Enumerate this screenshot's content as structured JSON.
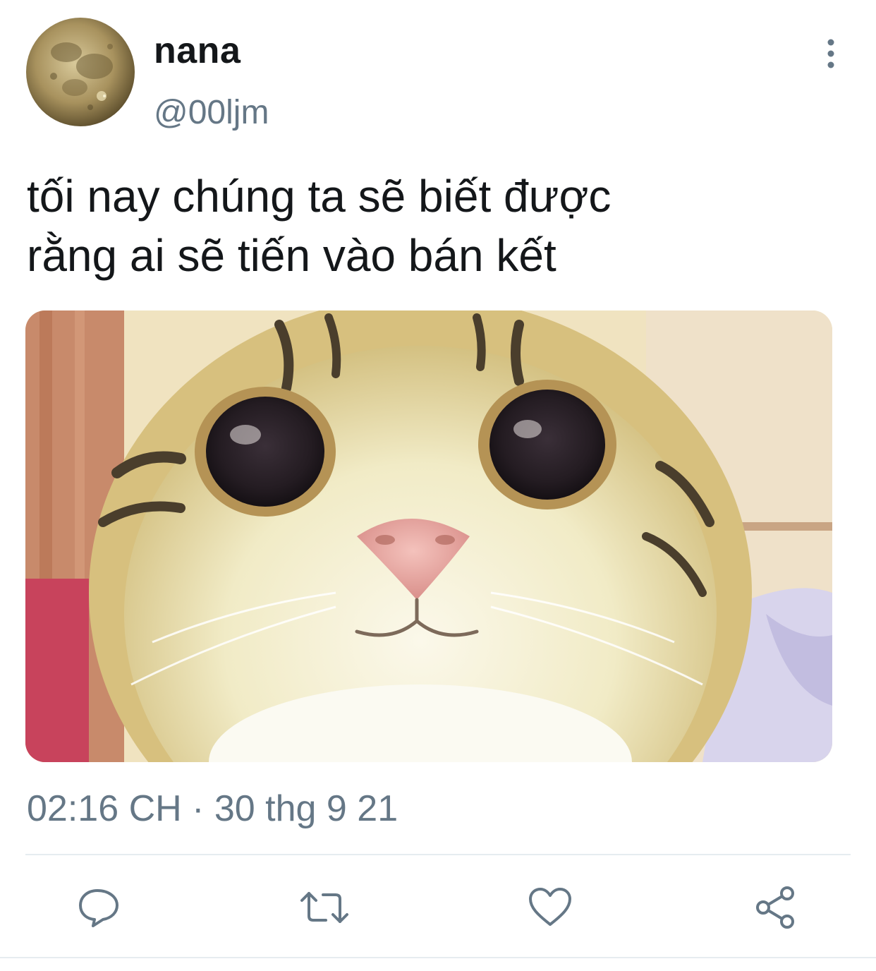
{
  "tweet": {
    "author": {
      "display_name": "nana",
      "handle": "@00ljm",
      "avatar_icon": "moon-avatar"
    },
    "more_icon": "more-vertical-icon",
    "text_lines": [
      "tối nay chúng ta sẽ biết được",
      "rằng ai sẽ tiến vào bán kết"
    ],
    "media": {
      "kind": "image",
      "subject": "smiling-cat-photo"
    },
    "timestamp": "02:16 CH · 30 thg 9 21",
    "actions": [
      {
        "name": "reply",
        "icon": "speech-bubble-icon"
      },
      {
        "name": "retweet",
        "icon": "retweet-arrows-icon"
      },
      {
        "name": "like",
        "icon": "heart-icon"
      },
      {
        "name": "share",
        "icon": "share-nodes-icon"
      }
    ]
  },
  "colors": {
    "text_primary": "#14171a",
    "text_secondary": "#657786",
    "icon_gray": "#657786",
    "divider": "#e6ecf0",
    "background": "#ffffff"
  }
}
